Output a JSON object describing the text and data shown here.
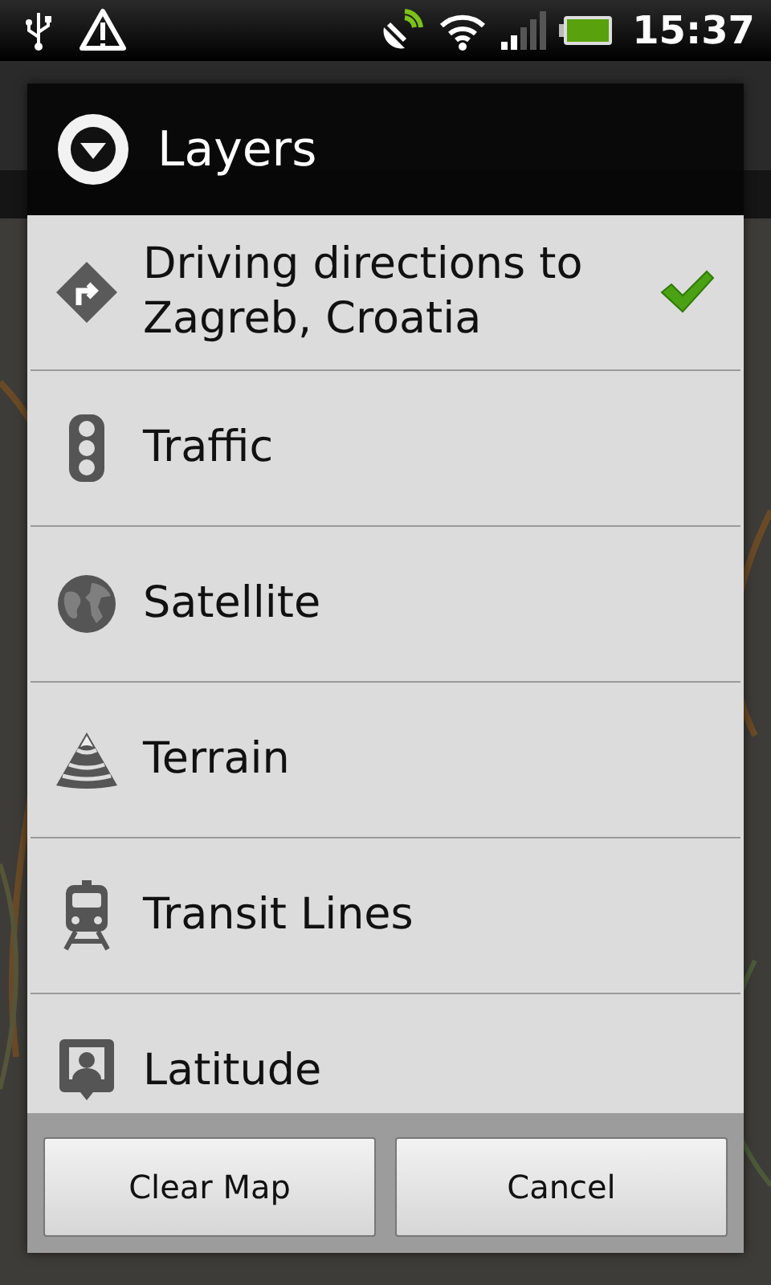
{
  "status_bar": {
    "time": "15:37"
  },
  "dialog": {
    "title": "Layers",
    "items": [
      {
        "kind": "directions",
        "label": "Driving directions to Zagreb, Croatia",
        "checked": true
      },
      {
        "kind": "traffic",
        "label": "Traffic",
        "checked": false
      },
      {
        "kind": "satellite",
        "label": "Satellite",
        "checked": false
      },
      {
        "kind": "terrain",
        "label": "Terrain",
        "checked": false
      },
      {
        "kind": "transit",
        "label": "Transit Lines",
        "checked": false
      },
      {
        "kind": "latitude",
        "label": "Latitude",
        "checked": false
      }
    ],
    "buttons": [
      "Clear Map",
      "Cancel"
    ]
  }
}
